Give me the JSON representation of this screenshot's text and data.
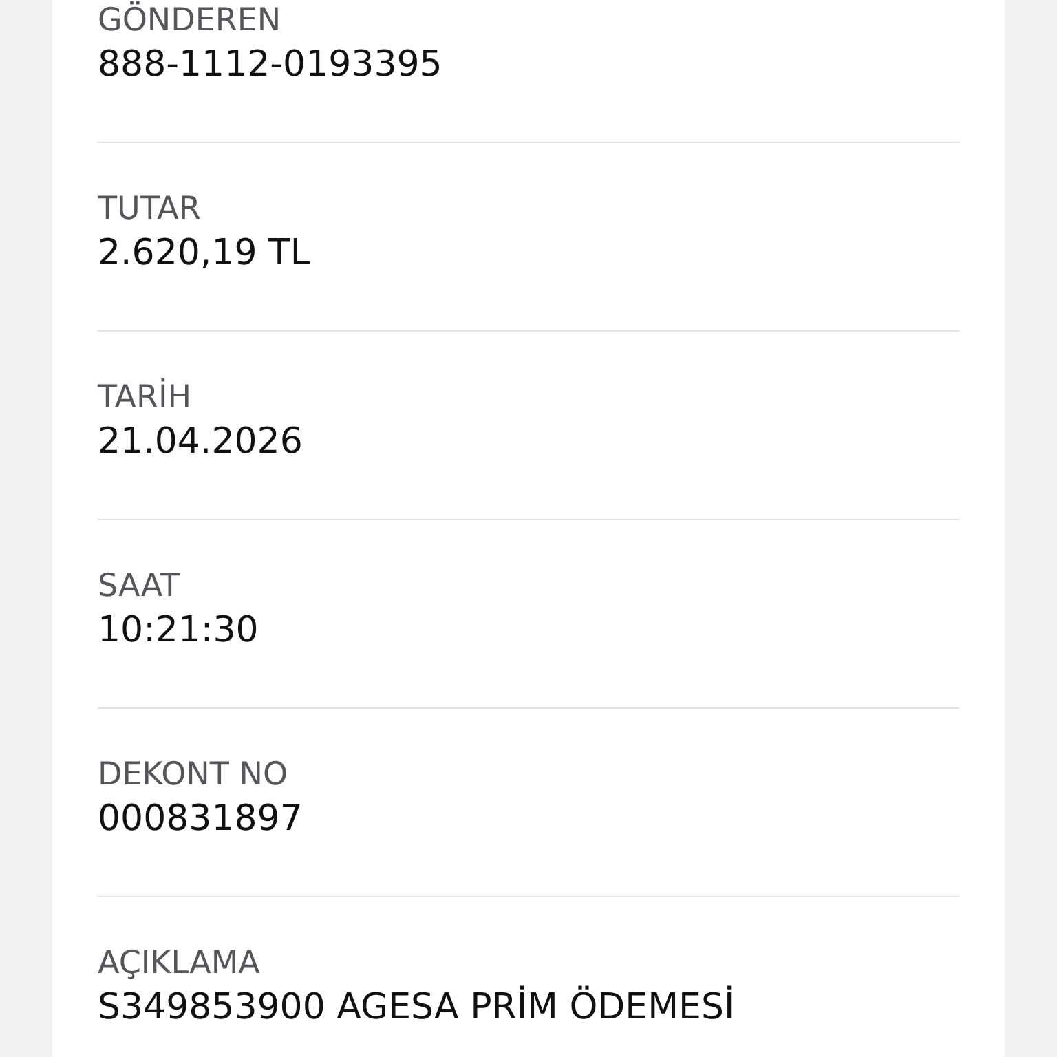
{
  "fields": [
    {
      "label": "GÖNDEREN",
      "value": "888-1112-0193395"
    },
    {
      "label": "TUTAR",
      "value": "2.620,19 TL"
    },
    {
      "label": "TARİH",
      "value": "21.04.2026"
    },
    {
      "label": "SAAT",
      "value": "10:21:30"
    },
    {
      "label": "DEKONT NO",
      "value": "000831897"
    },
    {
      "label": "AÇIKLAMA",
      "value": "S349853900 AGESA PRİM ÖDEMESİ"
    }
  ]
}
